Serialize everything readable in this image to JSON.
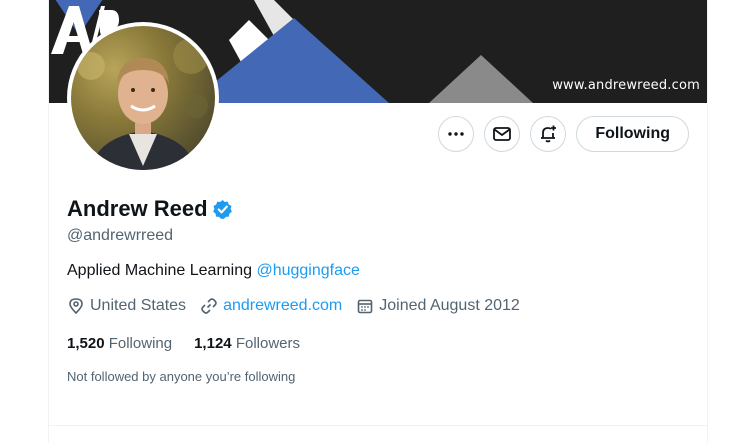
{
  "banner": {
    "site_text": "www.andrewreed.com",
    "logo_text": "AR",
    "colors": {
      "background": "#1f1f1f",
      "accent_blue": "#4368b5",
      "white": "#ffffff",
      "grey": "#8a8a8a"
    }
  },
  "profile": {
    "name": "Andrew Reed",
    "verified_icon": "verified-badge-icon",
    "handle": "@andrewrreed",
    "bio_text": "Applied Machine Learning ",
    "bio_mention": "@huggingface",
    "location": "United States",
    "website": "andrewreed.com",
    "joined": "Joined August 2012",
    "following_count": "1,520",
    "following_label": "Following",
    "followers_count": "1,124",
    "followers_label": "Followers",
    "followed_by_note": "Not followed by anyone you’re following"
  },
  "actions": {
    "more_icon": "more-horizontal-icon",
    "message_icon": "mail-icon",
    "notify_icon": "bell-plus-icon",
    "follow_label": "Following"
  },
  "accent": "#1d9bf0"
}
